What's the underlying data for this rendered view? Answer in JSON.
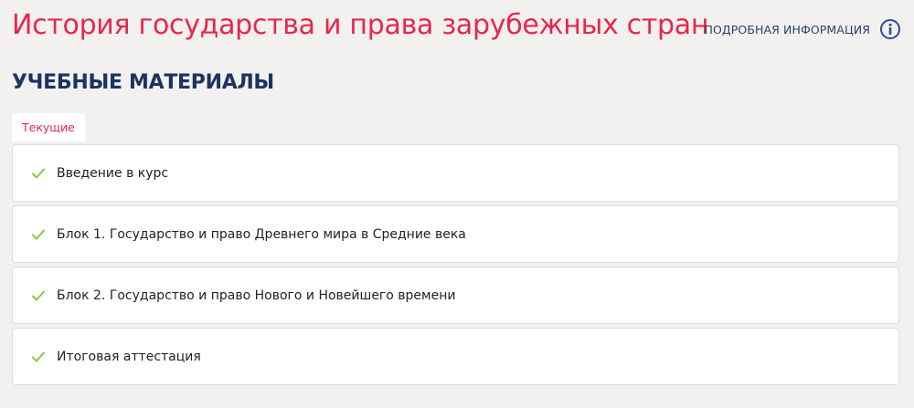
{
  "header": {
    "course_title": "История государства и права зарубежных стран",
    "info_link_label": "ПОДРОБНАЯ ИНФОРМАЦИЯ",
    "info_icon": "info-circle-icon"
  },
  "materials": {
    "heading": "УЧЕБНЫЕ МАТЕРИАЛЫ",
    "active_tab": "Текущие",
    "modules": [
      {
        "title": "Введение в курс",
        "status_icon": "check-icon",
        "completed": true
      },
      {
        "title": "Блок 1. Государство и право Древнего мира в Средние века",
        "status_icon": "check-icon",
        "completed": true
      },
      {
        "title": "Блок 2. Государство и право Нового и Новейшего времени",
        "status_icon": "check-icon",
        "completed": true
      },
      {
        "title": "Итоговая аттестация",
        "status_icon": "check-icon",
        "completed": true
      }
    ]
  },
  "colors": {
    "title_red": "#e8264a",
    "heading_navy": "#1d3360",
    "link_blue": "#2a3f6a",
    "check_green": "#8cc63f",
    "background": "#f2f1ef"
  }
}
